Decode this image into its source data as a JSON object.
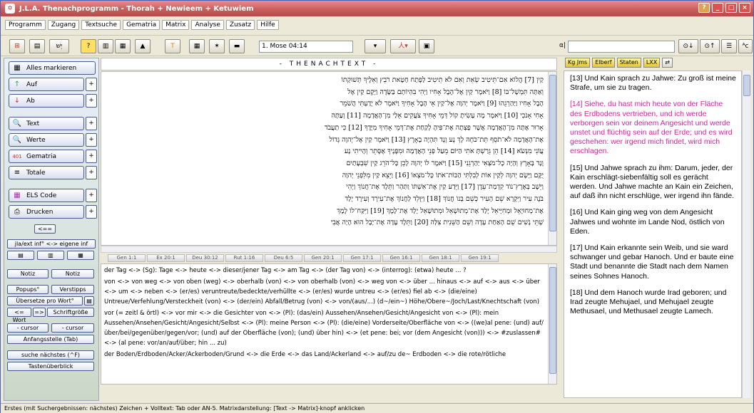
{
  "window": {
    "title": "J.L.A. Thenachprogramm - Thorah + Newieem + Ketuwiem"
  },
  "menu": [
    "Programm",
    "Zugang",
    "Textsuche",
    "Gematria",
    "Matrix",
    "Analyse",
    "Zusatz",
    "Hilfe"
  ],
  "toolbar": {
    "reference": "1. Mose 04:14",
    "search_prefix": "α|",
    "heb_label": "יְשׁ"
  },
  "left": {
    "mark_all": "Alles markieren",
    "up": "Auf",
    "down": "Ab",
    "text": "Text",
    "values": "Werte",
    "gematria": "Gematria",
    "totals": "Totale",
    "els": "ELS Code",
    "print": "Drucken",
    "link_toggle": "jla/ext inf° <-> eigene inf",
    "note1": "Notiz",
    "note2": "Notiz",
    "popups": "Popups°",
    "tips": "Verstipps",
    "translate": "Übersetze pro Wort°",
    "word": "<= Wort",
    "arrow": "=>",
    "fontsize": "Schriftgröße",
    "cursor_minus": "- cursor",
    "cursor_minus2": "- cursor",
    "start": "Anfangsstelle (Tab)",
    "next": "suche nächstes (^F)",
    "keys": "Tastenüberblick"
  },
  "center": {
    "header": "- THENACHTEXT -",
    "hebrew_lines": [
      "קַיִן [7] הֲלוֹא אִם־תֵּיטִיב שְׂאֵת וְאִם לֹא תֵיטִיב לַפֶּתַח חַטָּאת רֹבֵץ וְאֵלֶיךָ תְּשׁוּקָתוֹ",
      "וְאַתָּה תִּמְשָׁל־בּוֹ [8] וַיֹּאמֶר קַיִן אֶל־הֶבֶל אָחִיו וַיְהִי בִּהְיוֹתָם בַּשָּׂדֶה וַיָּקָם קַיִן אֶל",
      "הֶבֶל אָחִיו וַיַּהַרְגֵהוּ [9] וַיֹּאמֶר יְהוָה אֶל־קַיִן אֵי הֶבֶל אָחִיךָ וַיֹּאמֶר לֹא יָדַעְתִּי הֲשֹׁמֵר",
      "אָחִי אָנֹכִי [10] וַיֹּאמֶר מֶה עָשִׂיתָ קוֹל דְּמֵי אָחִיךָ צֹעֲקִים אֵלַי מִן־הָאֲדָמָה [11] וְעַתָּה",
      "אָרוּר אָתָּה מִן־הָאֲדָמָה אֲשֶׁר פָּצְתָה אֶת־פִּיהָ לָקַחַת אֶת־דְּמֵי אָחִיךָ מִיָּדֶךָ [12] כִּי תַעֲבֹד",
      "אֶת־הָאֲדָמָה לֹא־תֹסֵף תֵּת־כֹּחָהּ לָךְ נָע וָנָד תִּהְיֶה בָאָרֶץ [13] וַיֹּאמֶר קַיִן אֶל־יְהוָה גָּדוֹל",
      "עֲוֹנִי מִנְּשֹׂא [14] הֵן גֵּרַשְׁתָּ אֹתִי הַיּוֹם מֵעַל פְּנֵי הָאֲדָמָה וּמִפָּנֶיךָ אֶסָּתֵר וְהָיִיתִי נָע",
      "וָנָד בָּאָרֶץ וְהָיָה כָל־מֹצְאִי יַהַרְגֵנִי [15] וַיֹּאמֶר לוֹ יְהוָה לָכֵן כָּל־הֹרֵג קַיִן שִׁבְעָתַיִם",
      "יֻקָּם וַיָּשֶׂם יְהוָה לְקַיִן אוֹת לְבִלְתִּי הַכּוֹת־אֹתוֹ כָּל־מֹצְאוֹ [16] וַיֵּצֵא קַיִן מִלִּפְנֵי יְהוָה",
      "וַיֵּשֶׁב בְּאֶרֶץ־נוֹד קִדְמַת־עֵדֶן [17] וַיֵּדַע קַיִן אֶת־אִשְׁתּוֹ וַתַּהַר וַתֵּלֶד אֶת־חֲנוֹךְ וַיְהִי",
      "בֹּנֶה עִיר וַיִּקְרָא שֵׁם הָעִיר כְּשֵׁם בְּנוֹ חֲנוֹךְ [18] וַיִּוָּלֵד לַחֲנוֹךְ אֶת־עִירָד וְעִירָד יָלַד",
      "אֶת־מְחוּיָאֵל וּמְחִיָּיאֵל יָלַד אֶת־מְתוּשָׁאֵל וּמְתוּשָׁאֵל יָלַד אֶת־לָמֶךְ [19] וַיִּקַּח־לוֹ לֶמֶךְ",
      "שְׁתֵּי נָשִׁים שֵׁם הָאַחַת עָדָה וְשֵׁם הַשֵּׁנִית צִלָּה [20] וַתֵּלֶד עָדָה אֶת־יָבָל הוּא הָיָה אֲבִי"
    ],
    "jumps": [
      "Gen 1:1",
      "Ex 20:1",
      "Deu 30:12",
      "Rut 1:16",
      "Deu 6:5",
      "Gen 20:1",
      "Gen 17:1",
      "Gen 16:1",
      "Gen 18:1",
      "Gen 19:1"
    ],
    "wordlist": [
      "der Tag <-> (Sg): Tage <-> heute <-> dieser/jener Tag <-> am Tag <-> (der Tag von) <-> (interrog): (etwa) heute ... ?",
      "von <-> von weg <-> von oben (weg) <-> oberhalb (von) <-> von oberhalb (von) <-> weg von <-> über ... hinaus <-> auf <-> aus <-> über <-> um <-> neben <-> (er/es) veruntreute/bedeckte/verhüllte <-> (er/es) wurde untreu <-> (er/es) fiel ab <-> (die/eine) Untreue/Verfehlung/Versteckheit (von) <-> (der/ein) Abfall/Betrug (von) <-> von/(aus/...) (d~/ein~) Höhe/Obere~/Joch/Last/Knechtschaft (von)",
      "vor (= zeitl & örtl) <-> vor mir <-> die Gesichter von <-> (Pl): (das/ein) Aussehen/Ansehen/Gesicht/Angesicht von <-> (Pl): mein Aussehen/Ansehen/Gesicht/Angesicht/Selbst <-> (Pl): meine Person <-> (Pl): (die/eine) Vorderseite/Oberfläche von <-> ((we)al pene: (und) auf/über/bei/gegenüber/gegen/vor; (und) auf der Oberfläche (von); (und) über hin) <-> (et pene: bei; vor (dem Angesicht (von))) <-> #zuslassen# <-> (al pene: vor/an/auf/über; hin ... zu)",
      "der Boden/Erdboden/Acker/Ackerboden/Grund <-> die Erde <-> das Land/Ackerland <-> auf/zu de~ Erdboden <-> die rote/rötliche"
    ]
  },
  "right": {
    "tabs": [
      "Kg Jms",
      "Elberf",
      "Staten",
      "LXX"
    ],
    "verses": [
      "[13] Und Kain sprach zu Jahwe: Zu groß ist meine Strafe, um sie zu tragen.",
      "[14] Siehe, du hast mich heute von der Fläche des Erdbodens vertrieben, und ich werde verborgen sein vor deinem Angesicht und werde unstet und flüchtig sein auf der Erde; und es wird geschehen: wer irgend mich findet, wird mich erschlagen.",
      "[15] Und Jahwe sprach zu ihm: Darum, jeder, der Kain erschlägt-siebenfältig soll es gerächt werden. Und Jahwe machte an Kain ein Zeichen, auf daß ihn nicht erschlüge, wer irgend ihn fände.",
      "[16] Und Kain ging weg von dem Angesicht Jahwes und wohnte im Lande Nod, östlich von Eden.",
      "[17] Und Kain erkannte sein Weib, und sie ward schwanger und gebar Hanoch. Und er baute eine Stadt und benannte die Stadt nach dem Namen seines Sohnes Hanoch.",
      "[18] Und dem Hanoch wurde Irad geboren; und Irad zeugte Mehujael, und Mehujael zeugte Methusael, und Methusael zeugte Lamech."
    ]
  },
  "status": "Erstes (mit Suchergebnissen: nächstes) Zeichen + Volltext: Tab oder AN-5. Matrixdarstellung: [Text -> Matrix]-knopf anklicken"
}
